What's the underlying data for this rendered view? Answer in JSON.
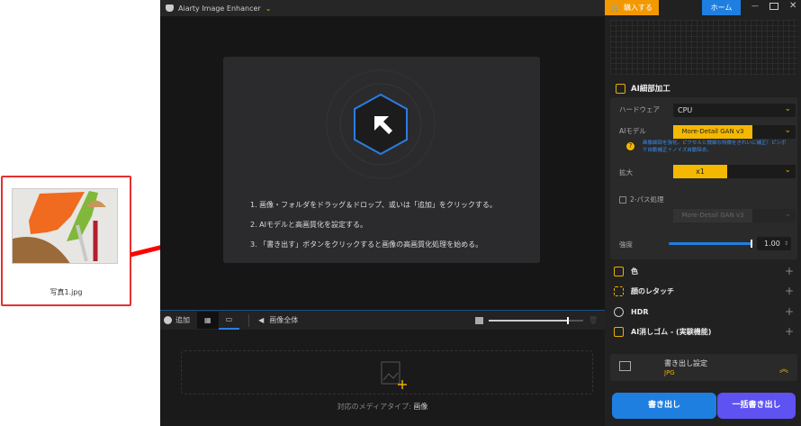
{
  "file_card": {
    "filename": "写真1.jpg"
  },
  "app": {
    "title": "Aiarty Image Enhancer",
    "buy_label": "購入する",
    "home_label": "ホーム",
    "steps": [
      "1. 画像・フォルダをドラッグ＆ドロップ、或いは「追加」をクリックする。",
      "2. AIモデルと高画質化を設定する。",
      "3. 「書き出す」ボタンをクリックすると画像の高画質化処理を始める。"
    ],
    "toolbar": {
      "add_label": "追加",
      "whole_image_label": "画像全体",
      "zoom_level": 0.88
    },
    "media_type_label": "対応のメディアタイプ:",
    "media_type_value": "画像",
    "panel": {
      "section_title": "AI細部加工",
      "hardware_label": "ハードウェア",
      "hardware_value": "CPU",
      "model_label": "AIモデル",
      "model_value": "More-Detail GAN  v3",
      "model_help": "画像細部を強化。ピクセルと微細な特徴をきれいに補正！ピンボケ自動補正＋ノイズ自動除去。",
      "scale_label": "拡大",
      "scale_value": "x1",
      "two_pass_label": "2-パス処理",
      "two_pass_checked": false,
      "two_pass_model": "More-Detail GAN  v3",
      "strength_label": "強度",
      "strength_value": "1.00",
      "features": [
        "色",
        "顔のレタッチ",
        "HDR",
        "AI消しゴム - (実験機能)"
      ],
      "export_settings_label": "書き出し設定",
      "export_format": "JPG",
      "export_label": "書き出し",
      "batch_export_label": "一括書き出し"
    },
    "colors": {
      "accent_yellow": "#f5b800",
      "accent_blue": "#1f7fe0",
      "buy_orange": "#f39800",
      "batch_purple": "#6a4cf0"
    }
  }
}
